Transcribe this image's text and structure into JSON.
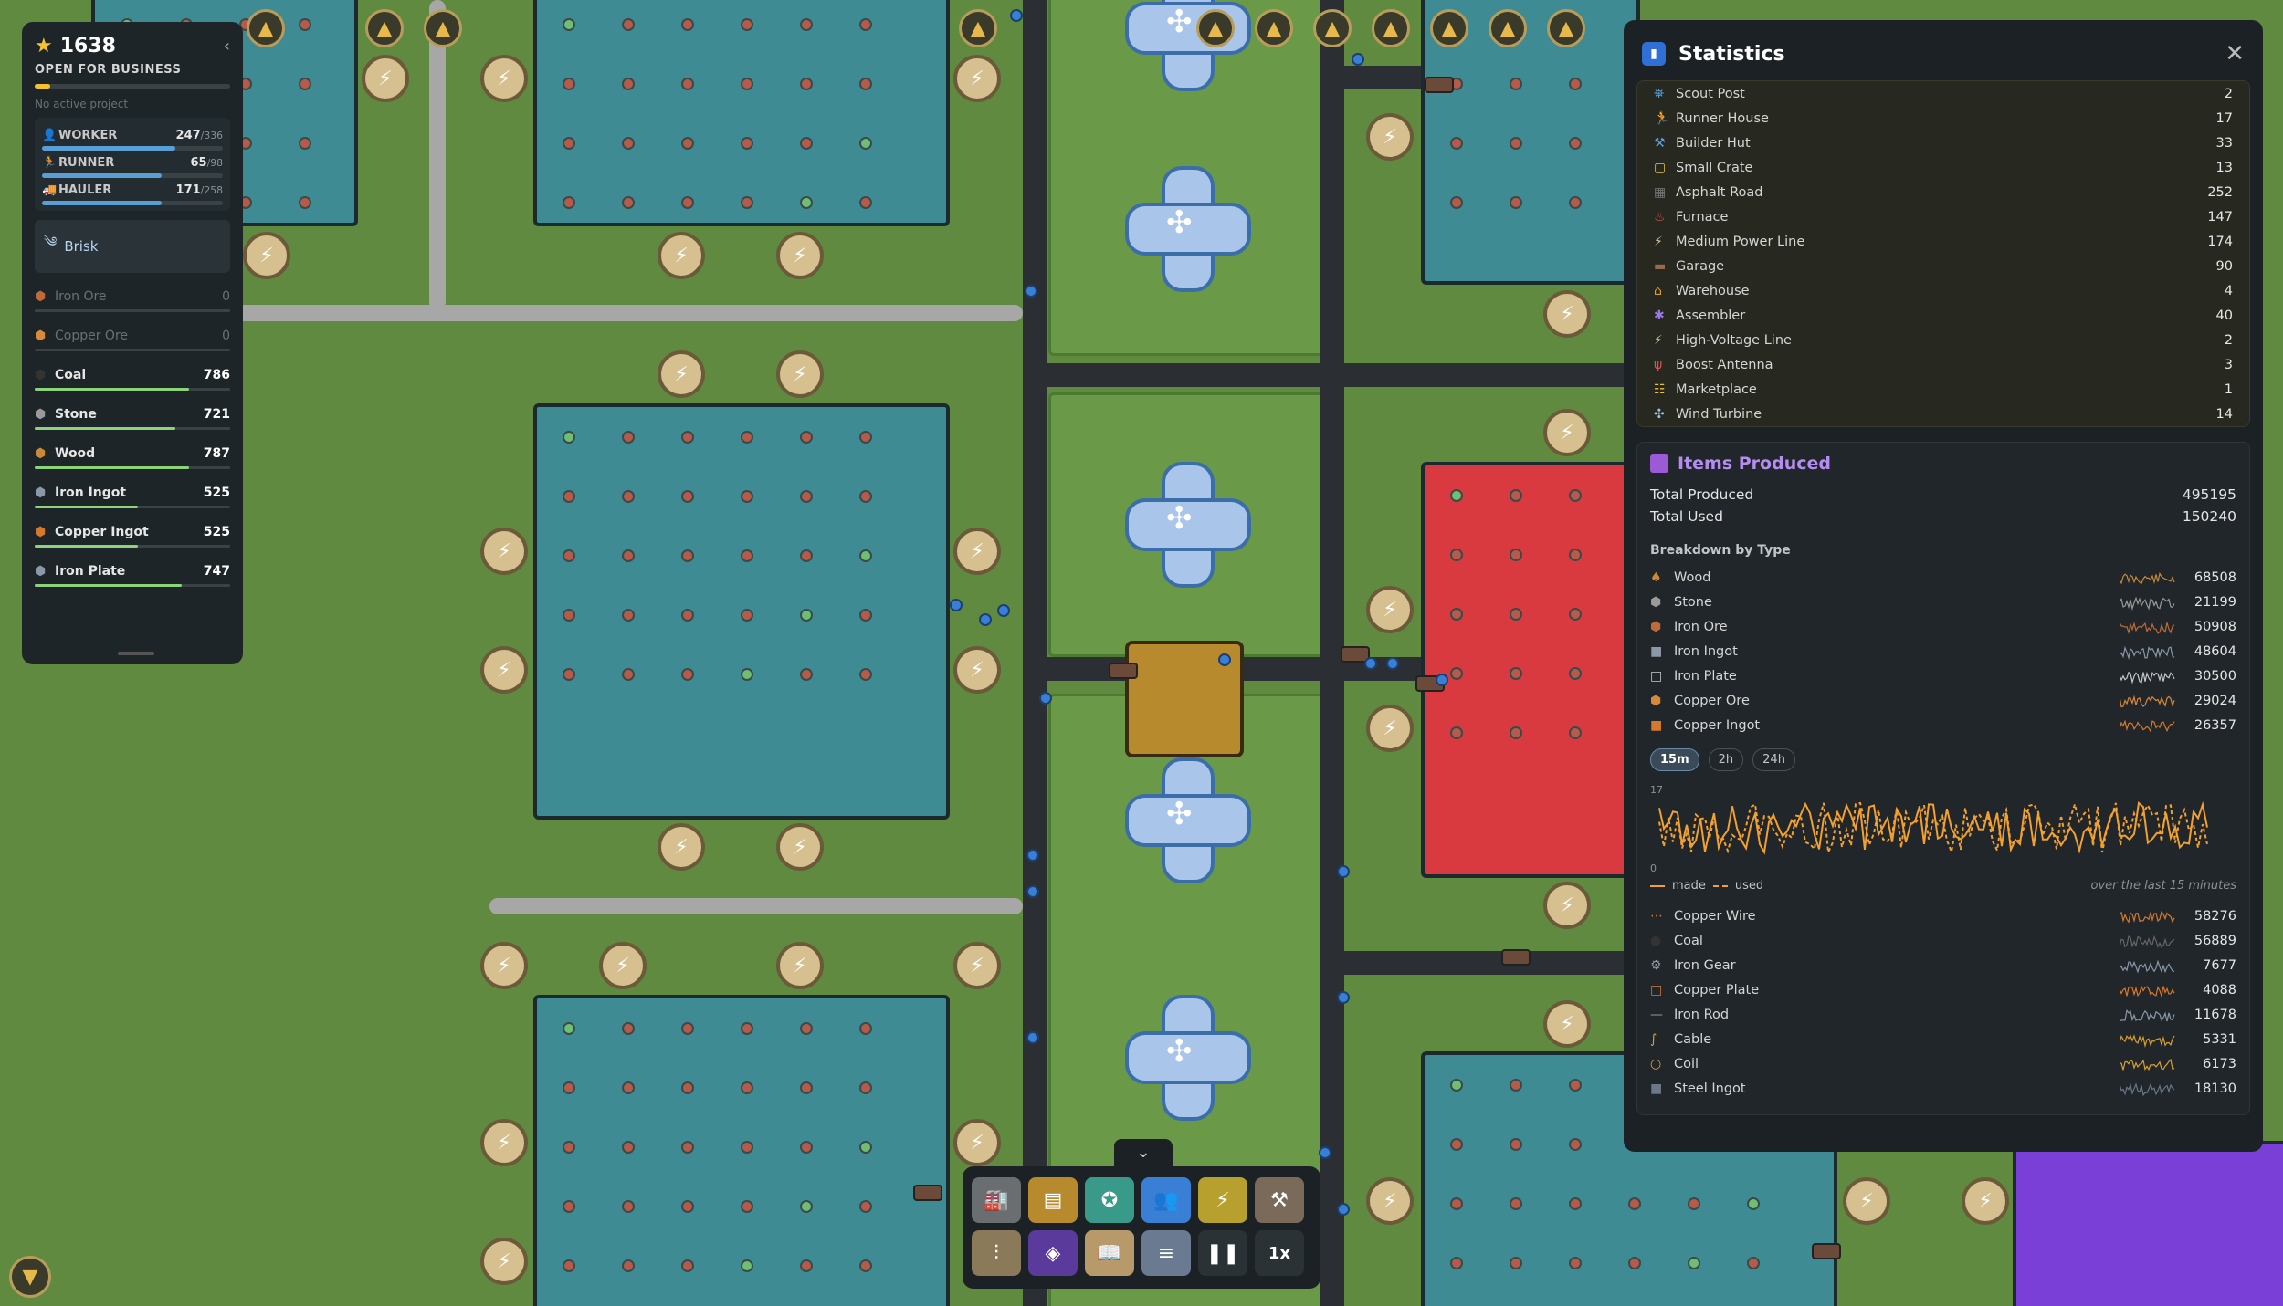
{
  "hud": {
    "score": "1638",
    "status": "OPEN FOR BUSINESS",
    "project_note": "No active project",
    "workers": [
      {
        "label": "WORKER",
        "value": "247",
        "max": "/336",
        "fill": 0.735
      },
      {
        "label": "RUNNER",
        "value": "65",
        "max": "/98",
        "fill": 0.663
      },
      {
        "label": "HAULER",
        "value": "171",
        "max": "/258",
        "fill": 0.663
      }
    ],
    "weather": "Brisk",
    "resources": [
      {
        "name": "Iron Ore",
        "value": "0",
        "dim": true,
        "color": "#c06a3a",
        "fill": 0
      },
      {
        "name": "Copper Ore",
        "value": "0",
        "dim": true,
        "color": "#d88a3a",
        "fill": 0
      },
      {
        "name": "Coal",
        "value": "786",
        "dim": false,
        "color": "#333333",
        "fill": 0.79
      },
      {
        "name": "Stone",
        "value": "721",
        "dim": false,
        "color": "#9a9a9a",
        "fill": 0.72
      },
      {
        "name": "Wood",
        "value": "787",
        "dim": false,
        "color": "#c88a3a",
        "fill": 0.79
      },
      {
        "name": "Iron Ingot",
        "value": "525",
        "dim": false,
        "color": "#8a98a8",
        "fill": 0.53
      },
      {
        "name": "Copper Ingot",
        "value": "525",
        "dim": false,
        "color": "#d8782a",
        "fill": 0.53
      },
      {
        "name": "Iron Plate",
        "value": "747",
        "dim": false,
        "color": "#8a98a8",
        "fill": 0.75
      }
    ]
  },
  "stats": {
    "title": "Statistics",
    "buildings": [
      {
        "name": "Scout Post",
        "value": "2",
        "icon": "⛯",
        "color": "#5aa3e6"
      },
      {
        "name": "Runner House",
        "value": "17",
        "icon": "🏃",
        "color": "#f2a030"
      },
      {
        "name": "Builder Hut",
        "value": "33",
        "icon": "⚒",
        "color": "#5aa3e6"
      },
      {
        "name": "Small Crate",
        "value": "13",
        "icon": "▢",
        "color": "#e6c040"
      },
      {
        "name": "Asphalt Road",
        "value": "252",
        "icon": "▦",
        "color": "#777777"
      },
      {
        "name": "Furnace",
        "value": "147",
        "icon": "♨",
        "color": "#e05050"
      },
      {
        "name": "Medium Power Line",
        "value": "174",
        "icon": "⚡",
        "color": "#d6c8a0"
      },
      {
        "name": "Garage",
        "value": "90",
        "icon": "▬",
        "color": "#9a6a4a"
      },
      {
        "name": "Warehouse",
        "value": "4",
        "icon": "⌂",
        "color": "#d6a030"
      },
      {
        "name": "Assembler",
        "value": "40",
        "icon": "✱",
        "color": "#9a7ae6"
      },
      {
        "name": "High-Voltage Line",
        "value": "2",
        "icon": "⚡",
        "color": "#d6c8a0"
      },
      {
        "name": "Boost Antenna",
        "value": "3",
        "icon": "ψ",
        "color": "#e05050"
      },
      {
        "name": "Marketplace",
        "value": "1",
        "icon": "☷",
        "color": "#e6c040"
      },
      {
        "name": "Wind Turbine",
        "value": "14",
        "icon": "✣",
        "color": "#9ac6ea"
      }
    ],
    "items_title": "Items Produced",
    "total_produced_label": "Total Produced",
    "total_produced": "495195",
    "total_used_label": "Total Used",
    "total_used": "150240",
    "breakdown_label": "Breakdown by Type",
    "items_top": [
      {
        "name": "Wood",
        "value": "68508",
        "icon": "♠",
        "color": "#c88a3a"
      },
      {
        "name": "Stone",
        "value": "21199",
        "icon": "⬢",
        "color": "#9a9a9a"
      },
      {
        "name": "Iron Ore",
        "value": "50908",
        "icon": "⬢",
        "color": "#c06a3a"
      },
      {
        "name": "Iron Ingot",
        "value": "48604",
        "icon": "■",
        "color": "#8a98a8"
      },
      {
        "name": "Iron Plate",
        "value": "30500",
        "icon": "□",
        "color": "#c8c8c8"
      },
      {
        "name": "Copper Ore",
        "value": "29024",
        "icon": "⬢",
        "color": "#d88a3a"
      },
      {
        "name": "Copper Ingot",
        "value": "26357",
        "icon": "■",
        "color": "#d8782a"
      }
    ],
    "ranges": [
      "15m",
      "2h",
      "24h"
    ],
    "chart_max": "17",
    "chart_min": "0",
    "legend_made": "made",
    "legend_used": "used",
    "chart_note": "over the last 15 minutes",
    "items_bottom": [
      {
        "name": "Copper Wire",
        "value": "58276",
        "icon": "⋯",
        "color": "#d8782a"
      },
      {
        "name": "Coal",
        "value": "56889",
        "icon": "●",
        "color": "#333333"
      },
      {
        "name": "Iron Gear",
        "value": "7677",
        "icon": "⚙",
        "color": "#8a98a8"
      },
      {
        "name": "Copper Plate",
        "value": "4088",
        "icon": "□",
        "color": "#d8782a"
      },
      {
        "name": "Iron Rod",
        "value": "11678",
        "icon": "—",
        "color": "#8a98a8"
      },
      {
        "name": "Cable",
        "value": "5331",
        "icon": "∫",
        "color": "#d8a030"
      },
      {
        "name": "Coil",
        "value": "6173",
        "icon": "○",
        "color": "#d8a030"
      },
      {
        "name": "Steel Ingot",
        "value": "18130",
        "icon": "■",
        "color": "#6a7888"
      }
    ]
  },
  "toolbar": {
    "row1": [
      {
        "icon": "factory-icon",
        "glyph": "🏭",
        "bg": "#6b6e70"
      },
      {
        "icon": "storage-icon",
        "glyph": "▤",
        "bg": "#b88a2e"
      },
      {
        "icon": "star-badge-icon",
        "glyph": "✪",
        "bg": "#3a9a8a"
      },
      {
        "icon": "people-icon",
        "glyph": "👥",
        "bg": "#3a7fd6"
      },
      {
        "icon": "power-icon",
        "glyph": "⚡",
        "bg": "#b8a02e"
      },
      {
        "icon": "tools-icon",
        "glyph": "⚒",
        "bg": "#7a6a5a"
      }
    ],
    "row2": [
      {
        "icon": "sliders-icon",
        "glyph": "⫶",
        "bg": "#8a7a5a"
      },
      {
        "icon": "layers-icon",
        "glyph": "◈",
        "bg": "#5a3a9a"
      },
      {
        "icon": "book-icon",
        "glyph": "📖",
        "bg": "#b89a6a"
      },
      {
        "icon": "menu-icon",
        "glyph": "≡",
        "bg": "#6a7a90"
      }
    ],
    "pause": "❚❚",
    "speed": "1x",
    "chevron": "⌄"
  }
}
